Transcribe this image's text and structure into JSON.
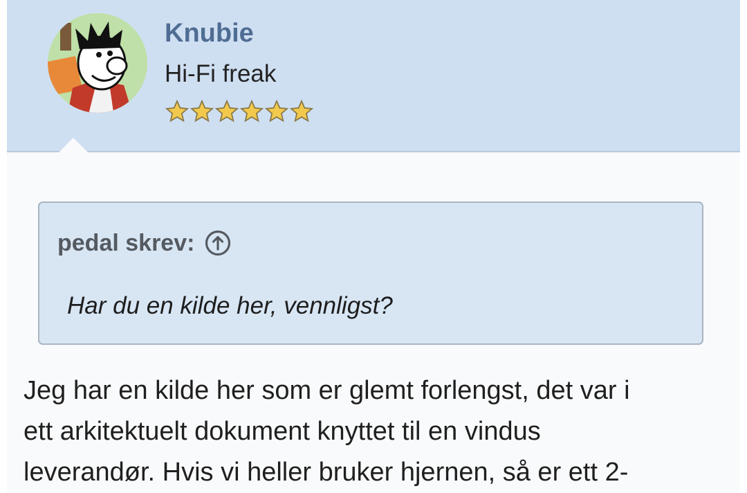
{
  "user": {
    "name": "Knubie",
    "title": "Hi-Fi freak",
    "rating_stars": 6,
    "rating_max": 6,
    "avatar_icon": "cartoon-character-avatar"
  },
  "quote": {
    "author_label": "pedal skrev:",
    "jump_icon": "arrow-up-circle-icon",
    "text": "Har du en kilde her, vennligst?"
  },
  "post": {
    "lines": [
      "Jeg har en kilde her som er glemt forlengst, det var i",
      "ett arkitektuelt dokument knyttet til en vindus",
      "leverandør. Hvis vi heller bruker hjernen, så er ett 2-"
    ]
  },
  "colors": {
    "header_bg": "#cfdff2",
    "username": "#4f6d93",
    "quote_bg": "#d8e6f4",
    "star": "#f2c94c"
  }
}
